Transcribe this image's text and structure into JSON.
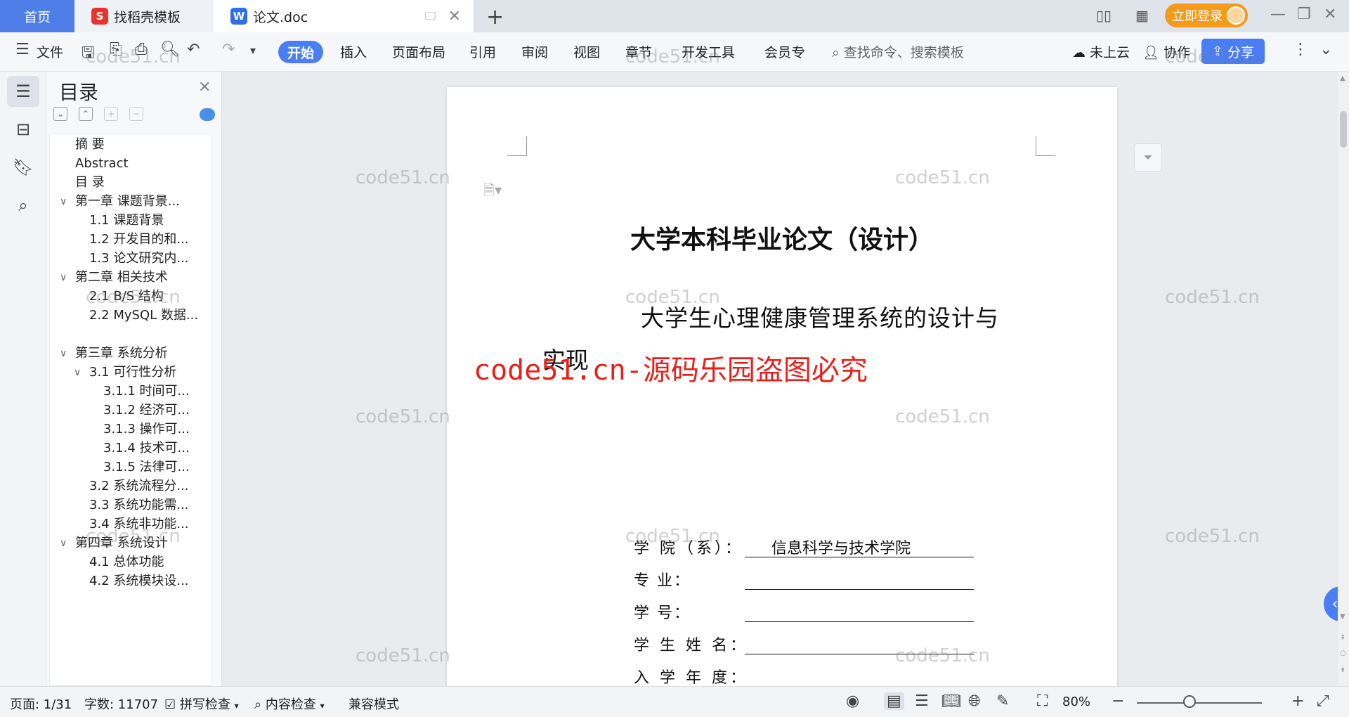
{
  "tabs": {
    "home": "首页",
    "templates": "找稻壳模板",
    "document": "论文.doc"
  },
  "topbar": {
    "login": "立即登录"
  },
  "ribbon": {
    "file": "文件",
    "menu": [
      "开始",
      "插入",
      "页面布局",
      "引用",
      "审阅",
      "视图",
      "章节",
      "开发工具",
      "会员专"
    ],
    "search_placeholder": "查找命令、搜索模板",
    "cloud": "未上云",
    "collab": "协作",
    "share": "分享"
  },
  "toc": {
    "title": "目录",
    "items": [
      "摘    要",
      "Abstract",
      "目    录",
      "第一章   课题背景...",
      "1.1 课题背景",
      "1.2 开发目的和...",
      "1.3 论文研究内...",
      "第二章  相关技术",
      "2.1 B/S 结构",
      "2.2 MySQL 数据...",
      "第三章  系统分析",
      "3.1 可行性分析",
      "3.1.1 时间可...",
      "3.1.2  经济可...",
      "3.1.3  操作可...",
      "3.1.4  技术可...",
      "3.1.5  法律可...",
      "3.2 系统流程分...",
      "3.3 系统功能需...",
      "3.4  系统非功能...",
      "第四章  系统设计",
      "4.1  总体功能",
      "4.2  系统模块设..."
    ]
  },
  "document": {
    "title": "大学本科毕业论文（设计）",
    "subtitle_line1": "大学生心理健康管理系统的设计与",
    "subtitle_line2": "实现",
    "form": [
      {
        "label": "学 院（系）：",
        "value": "信息科学与技术学院"
      },
      {
        "label": "专        业：",
        "value": ""
      },
      {
        "label": "学        号：",
        "value": ""
      },
      {
        "label": "学 生 姓 名：",
        "value": ""
      },
      {
        "label": "入 学 年 度：",
        "value": ""
      }
    ]
  },
  "watermark": {
    "text": "code51.cn",
    "red_text": "code51.cn-源码乐园盗图必究"
  },
  "statusbar": {
    "page": "页面: 1/31",
    "words": "字数: 11707",
    "spellcheck": "拼写检查",
    "content_check": "内容检查",
    "compat": "兼容模式",
    "zoom": "80%",
    "zoom_level_percent": 80
  },
  "colors": {
    "accent": "#4a7ef5",
    "login": "#f59a1a",
    "watermark_red": "#e8201a"
  }
}
